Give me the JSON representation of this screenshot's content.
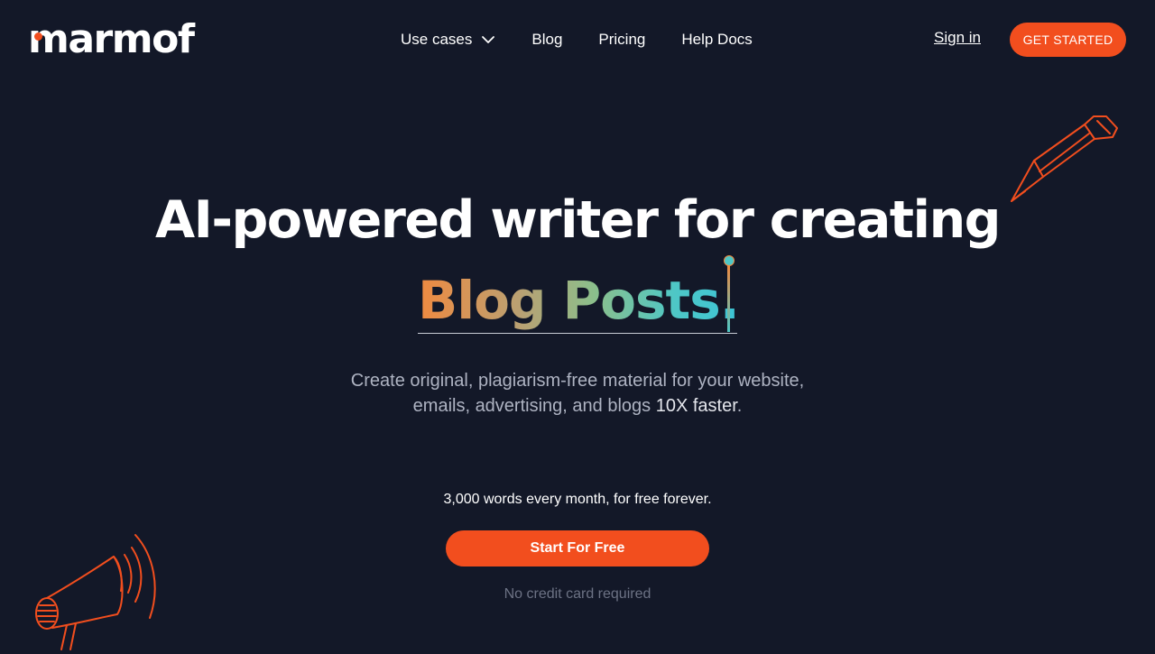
{
  "header": {
    "logo_text": "marmof",
    "nav": [
      {
        "label": "Use cases",
        "has_dropdown": true
      },
      {
        "label": "Blog"
      },
      {
        "label": "Pricing"
      },
      {
        "label": "Help Docs"
      }
    ],
    "sign_in": "Sign in",
    "get_started": "GET STARTED"
  },
  "hero": {
    "headline": "AI-powered writer for creating",
    "typed_text": "Blog Posts.",
    "subtitle_line1": "Create original, plagiarism-free material for your website,",
    "subtitle_line2": "emails, advertising, and blogs ",
    "subtitle_highlight": "10X faster",
    "subtitle_end": ".",
    "offer": "3,000 words every month, for free forever.",
    "cta": "Start For Free",
    "note": "No credit card required"
  },
  "icons": {
    "chevron": "chevron-down-icon",
    "pencil": "pencil-icon",
    "megaphone": "megaphone-icon"
  },
  "colors": {
    "background": "#131828",
    "accent": "#f24e1e",
    "subtitle": "#aeb3c2",
    "note": "#6c7284"
  }
}
